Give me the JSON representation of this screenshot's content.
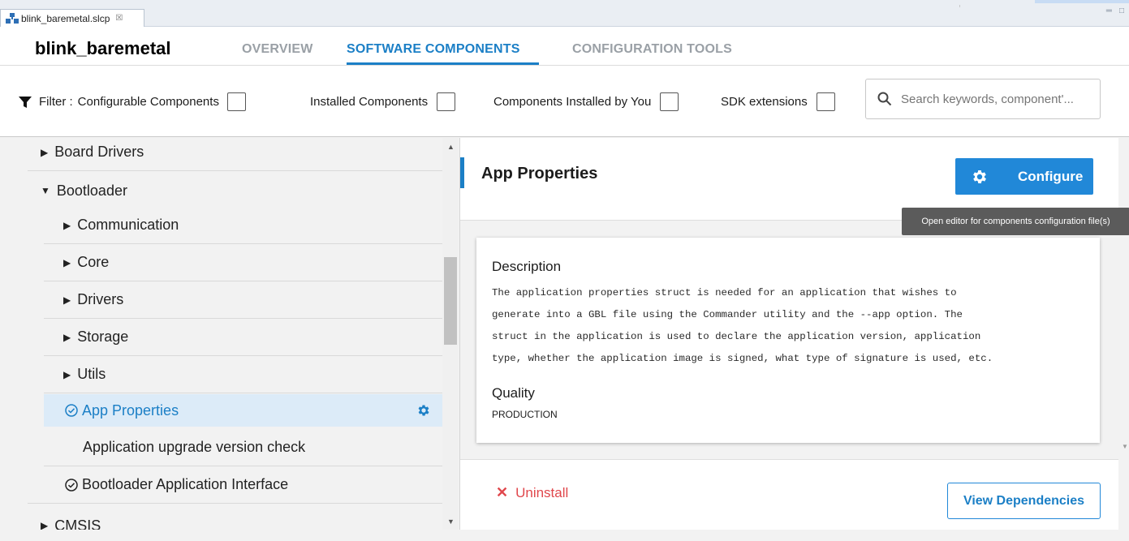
{
  "editor_tab": {
    "label": "blink_baremetal.slcp",
    "close": "☒"
  },
  "window_controls": {
    "minimize": "═",
    "maximize": "□"
  },
  "header": {
    "project": "blink_baremetal",
    "tabs": [
      "OVERVIEW",
      "SOFTWARE COMPONENTS",
      "CONFIGURATION TOOLS"
    ],
    "active_tab": "SOFTWARE COMPONENTS"
  },
  "filter": {
    "label": "Filter :",
    "options": [
      "Configurable Components",
      "Installed Components",
      "Components Installed by You",
      "SDK extensions"
    ],
    "search_placeholder": "Search keywords, component'..."
  },
  "tree": {
    "items": [
      {
        "label": "Board Drivers",
        "expander": "▶"
      },
      {
        "label": "Bootloader",
        "expander": "▼"
      },
      {
        "label": "Communication",
        "expander": "▶"
      },
      {
        "label": "Core",
        "expander": "▶"
      },
      {
        "label": "Drivers",
        "expander": "▶"
      },
      {
        "label": "Storage",
        "expander": "▶"
      },
      {
        "label": "Utils",
        "expander": "▶"
      },
      {
        "label": "App Properties",
        "status": "✓"
      },
      {
        "label": "Application upgrade version check"
      },
      {
        "label": "Bootloader Application Interface",
        "status": "✓"
      },
      {
        "label": "CMSIS",
        "expander": "▶"
      }
    ],
    "selected": "App Properties"
  },
  "detail": {
    "title": "App Properties",
    "configure_label": "Configure",
    "tooltip": "Open editor for components configuration file(s)",
    "description_heading": "Description",
    "description": "The application properties struct is needed for an application that wishes to\ngenerate into a GBL file using the Commander utility and the --app option. The\nstruct in the application is used to declare the application version, application\ntype, whether the application image is signed, what type of signature is used, etc.",
    "quality_heading": "Quality",
    "quality": "PRODUCTION",
    "uninstall_label": "Uninstall",
    "view_dependencies_label": "View Dependencies"
  },
  "colors": {
    "accent": "#1b7fc6",
    "button": "#2188d8",
    "danger": "#e0474c",
    "selected_row": "#dcebf8"
  }
}
